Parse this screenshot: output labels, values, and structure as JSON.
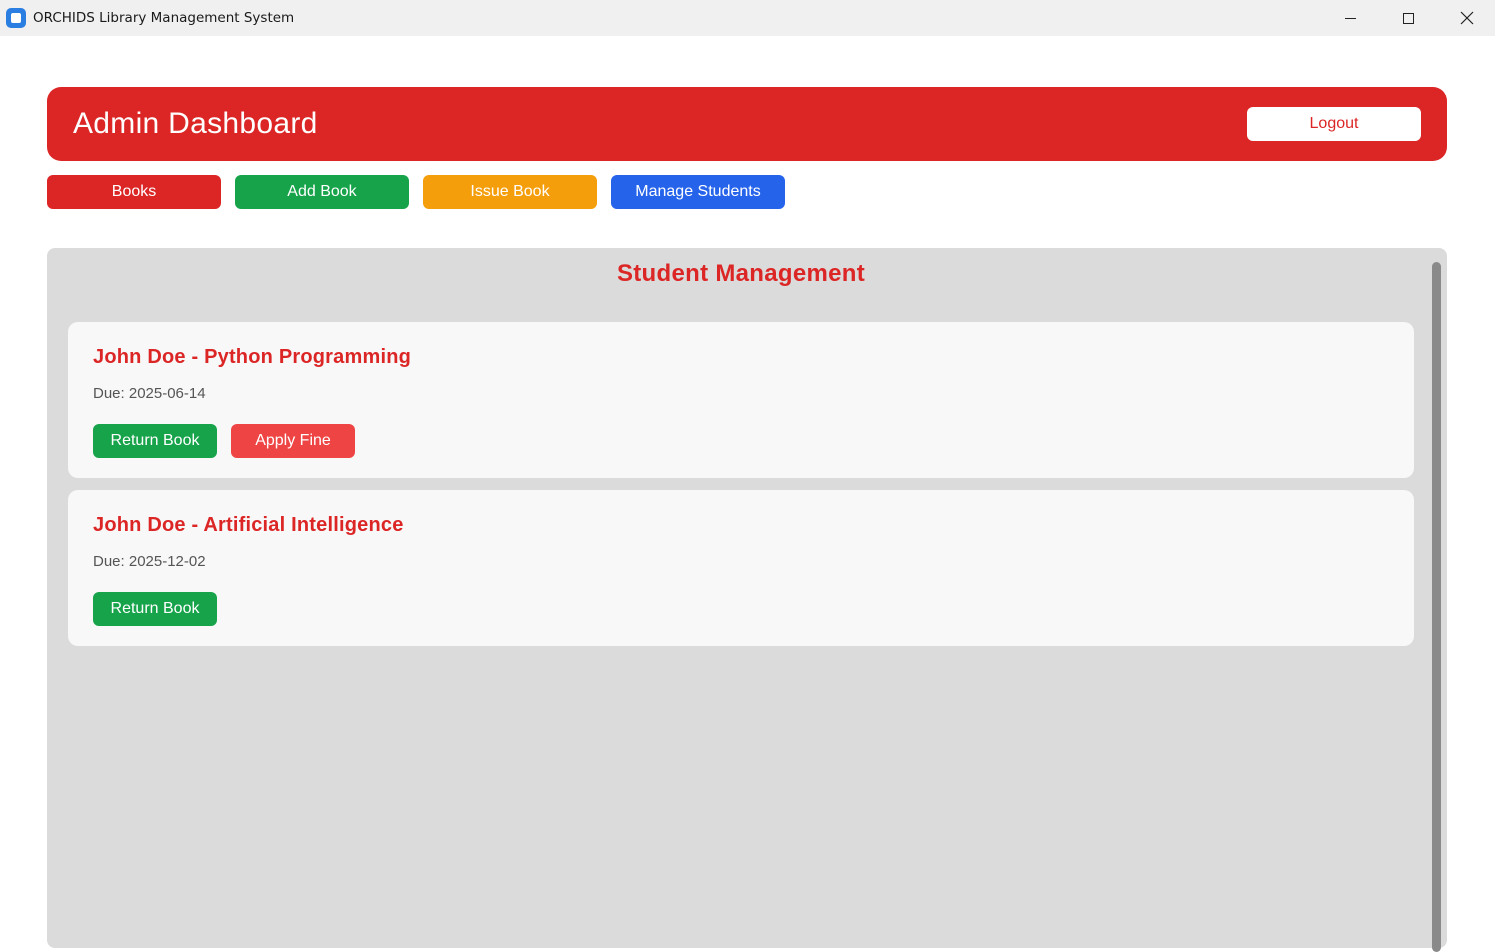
{
  "window": {
    "title": "ORCHIDS Library Management System"
  },
  "header": {
    "title": "Admin Dashboard",
    "logout_label": "Logout"
  },
  "nav": {
    "books": "Books",
    "add_book": "Add Book",
    "issue_book": "Issue Book",
    "manage_students": "Manage Students"
  },
  "panel": {
    "title": "Student Management"
  },
  "records": [
    {
      "title": "John Doe - Python Programming",
      "due": "Due: 2025-06-14",
      "return_label": "Return Book",
      "fine_label": "Apply Fine"
    },
    {
      "title": "John Doe - Artificial Intelligence",
      "due": "Due: 2025-12-02",
      "return_label": "Return Book"
    }
  ],
  "colors": {
    "primary_red": "#dc2626",
    "green": "#16a34a",
    "amber": "#f59e0b",
    "blue": "#2563eb",
    "fine_red": "#ef4444",
    "panel_bg": "#dbdbdb",
    "card_bg": "#f8f8f8"
  },
  "icons": {
    "app": "app-icon",
    "minimize": "minimize-icon",
    "maximize": "maximize-icon",
    "close": "close-icon"
  }
}
